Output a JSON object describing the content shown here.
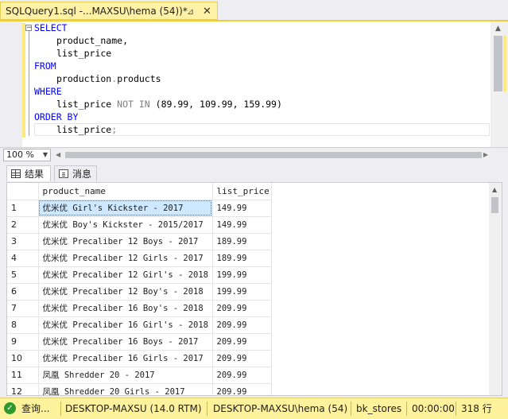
{
  "document_tab": {
    "title": "SQLQuery1.sql -...MAXSU\\hema (54))*",
    "pin_glyph": "⊿",
    "close_glyph": "✕"
  },
  "editor": {
    "lines": [
      {
        "indent": false,
        "parts": [
          {
            "t": "SELECT",
            "k": "kw"
          }
        ]
      },
      {
        "indent": true,
        "parts": [
          {
            "t": "product_name,",
            "k": ""
          }
        ]
      },
      {
        "indent": true,
        "parts": [
          {
            "t": "list_price",
            "k": ""
          }
        ]
      },
      {
        "indent": false,
        "parts": [
          {
            "t": "FROM",
            "k": "kw"
          }
        ]
      },
      {
        "indent": true,
        "parts": [
          {
            "t": "production",
            "k": ""
          },
          {
            "t": ".",
            "k": "gr"
          },
          {
            "t": "products",
            "k": ""
          }
        ]
      },
      {
        "indent": false,
        "parts": [
          {
            "t": "WHERE",
            "k": "kw"
          }
        ]
      },
      {
        "indent": true,
        "parts": [
          {
            "t": "list_price ",
            "k": ""
          },
          {
            "t": "NOT IN",
            "k": "gr"
          },
          {
            "t": " (89.99, 109.99, 159.99)",
            "k": ""
          }
        ]
      },
      {
        "indent": false,
        "parts": [
          {
            "t": "ORDER BY",
            "k": "kw"
          }
        ]
      },
      {
        "indent": true,
        "parts": [
          {
            "t": "list_price",
            "k": ""
          },
          {
            "t": ";",
            "k": "gr"
          }
        ]
      }
    ]
  },
  "zoom": {
    "value": "100 %"
  },
  "results_tabs": {
    "results_label": "结果",
    "messages_label": "消息"
  },
  "results": {
    "columns": [
      "product_name",
      "list_price"
    ],
    "selected_row": 0,
    "rows": [
      [
        "1",
        "优米优 Girl's Kickster - 2017",
        "149.99"
      ],
      [
        "2",
        "优米优 Boy's Kickster - 2015/2017",
        "149.99"
      ],
      [
        "3",
        "优米优 Precaliber 12 Boys - 2017",
        "189.99"
      ],
      [
        "4",
        "优米优 Precaliber 12 Girls - 2017",
        "189.99"
      ],
      [
        "5",
        "优米优 Precaliber 12 Girl's - 2018",
        "199.99"
      ],
      [
        "6",
        "优米优 Precaliber 12 Boy's - 2018",
        "199.99"
      ],
      [
        "7",
        "优米优 Precaliber 16 Boy's - 2018",
        "209.99"
      ],
      [
        "8",
        "优米优 Precaliber 16 Girl's - 2018",
        "209.99"
      ],
      [
        "9",
        "优米优 Precaliber 16 Boys - 2017",
        "209.99"
      ],
      [
        "10",
        "优米优 Precaliber 16 Girls - 2017",
        "209.99"
      ],
      [
        "11",
        "凤凰 Shredder 20 - 2017",
        "209.99"
      ],
      [
        "12",
        "凤凰 Shredder 20 Girls - 2017",
        "209.99"
      ]
    ]
  },
  "status": {
    "query_status": "查询...",
    "server": "DESKTOP-MAXSU (14.0 RTM)",
    "user": "DESKTOP-MAXSU\\hema (54)",
    "database": "bk_stores",
    "elapsed": "00:00:00",
    "rows": "318 行"
  },
  "colors": {
    "tab_accent": "#fff1a6",
    "status_bar": "#fff29d",
    "keyword": "#0000ff",
    "selection": "#cde8ff"
  }
}
